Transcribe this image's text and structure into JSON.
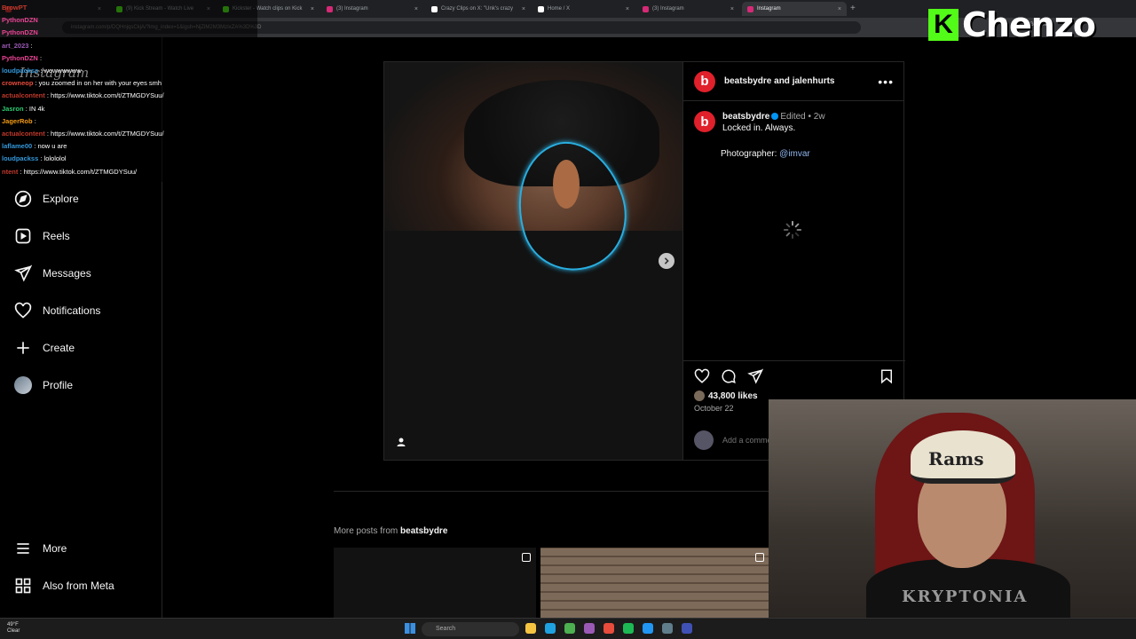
{
  "browser": {
    "tabs": [
      {
        "label": "",
        "color": "#e53935"
      },
      {
        "label": "(9) Kick Stream - Watch Live",
        "color": "#53fc18"
      },
      {
        "label": "Kickster - Watch clips on Kick",
        "color": "#53fc18"
      },
      {
        "label": "(3) Instagram",
        "color": "#d62976"
      },
      {
        "label": "Crazy Clips on X: \"Unk's crazy",
        "color": "#ffffff"
      },
      {
        "label": "Home / X",
        "color": "#ffffff"
      },
      {
        "label": "(3) Instagram",
        "color": "#d62976"
      },
      {
        "label": "Instagram",
        "color": "#d62976"
      }
    ],
    "url": "instagram.com/p/DQHnjqsCkjA/?img_index=1&igsh=NjZiM2M3MzIxZA%3D%3D",
    "gemini": "Gemini"
  },
  "sidebar": {
    "items": [
      {
        "label": "Explore",
        "icon": "compass-icon"
      },
      {
        "label": "Reels",
        "icon": "reels-icon"
      },
      {
        "label": "Messages",
        "icon": "messages-icon"
      },
      {
        "label": "Notifications",
        "icon": "heart-icon"
      },
      {
        "label": "Create",
        "icon": "plus-icon"
      },
      {
        "label": "Profile",
        "icon": "avatar"
      }
    ],
    "more": "More",
    "also_from_meta": "Also from Meta"
  },
  "post": {
    "header_names": "beatsbydre and jalenhurts",
    "logo_letter": "b",
    "caption_user": "beatsbydre",
    "caption_edited": "Edited • 2w",
    "caption_text": "Locked in. Always.",
    "photographer_label": "Photographer:",
    "photographer_mention": "@imvar",
    "likes": "43,800 likes",
    "date": "October 22",
    "comment_placeholder": "Add a comment..."
  },
  "more_posts": {
    "label": "More posts from",
    "user": "beatsbydre"
  },
  "chat": [
    {
      "user": "BrowPT",
      "msg": "",
      "color": "#c0392b"
    },
    {
      "user": "PythonDZN",
      "msg": "",
      "color": "#e84393"
    },
    {
      "user": "PythonDZN",
      "msg": "",
      "color": "#e84393"
    },
    {
      "user": "art_2023",
      "msg": ":",
      "color": "#9b59b6"
    },
    {
      "user": "PythonDZN",
      "msg": ":",
      "color": "#e84393"
    },
    {
      "user": "loudpackss",
      "msg": ": wowwwwww",
      "color": "#3498db"
    },
    {
      "user": "crowneop",
      "msg": ": you zoomed in on her with your eyes smh",
      "color": "#e74c3c"
    },
    {
      "user": "actualcontent",
      "msg": ": https://www.tiktok.com/t/ZTMGDYSuu/",
      "color": "#c0392b"
    },
    {
      "user": "Jasron",
      "msg": ": IN 4k",
      "color": "#2ecc71"
    },
    {
      "user": "JagerRob",
      "msg": ":",
      "color": "#f39c12"
    },
    {
      "user": "actualcontent",
      "msg": ": https://www.tiktok.com/t/ZTMGDYSuu/",
      "color": "#c0392b"
    },
    {
      "user": "laflame00",
      "msg": ": now u are",
      "color": "#3498db"
    },
    {
      "user": "loudpackss",
      "msg": ": lolololol",
      "color": "#3498db"
    },
    {
      "user": "ntent",
      "msg": ": https://www.tiktok.com/t/ZTMGDYSuu/",
      "color": "#c0392b"
    }
  ],
  "chat_watermark": "Instagram",
  "brand": {
    "letter": "K",
    "name": "Chenzo",
    "color": "#53fc18"
  },
  "webcam": {
    "cap_text": "Rams",
    "shirt_text": "KRYPTONIA"
  },
  "taskbar": {
    "weather_temp": "49°F",
    "weather_desc": "Clear",
    "search_placeholder": "Search",
    "apps": [
      {
        "name": "file-explorer-icon",
        "color": "#f5c542"
      },
      {
        "name": "edge-icon",
        "color": "#1fa2e0"
      },
      {
        "name": "chrome-icon",
        "color": "#4caf50"
      },
      {
        "name": "app-icon",
        "color": "#9b59b6"
      },
      {
        "name": "app-icon",
        "color": "#e74c3c"
      },
      {
        "name": "spotify-icon",
        "color": "#1db954"
      },
      {
        "name": "app-icon",
        "color": "#2196f3"
      },
      {
        "name": "app-icon",
        "color": "#607d8b"
      },
      {
        "name": "app-icon",
        "color": "#3f51b5"
      }
    ]
  }
}
